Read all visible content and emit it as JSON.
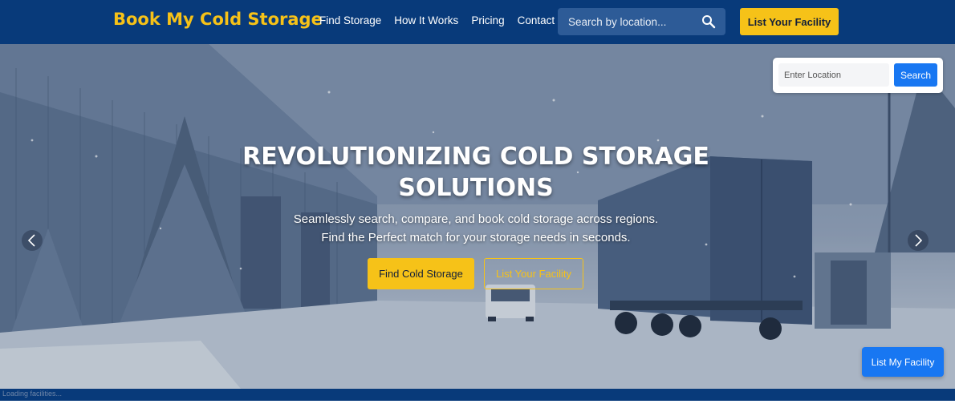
{
  "header": {
    "logo": "Book My Cold Storage",
    "nav": [
      {
        "label": "Find Storage"
      },
      {
        "label": "How It Works"
      },
      {
        "label": "Pricing"
      },
      {
        "label": "Contact"
      }
    ],
    "search_placeholder": "Search by location...",
    "list_button": "List Your Facility"
  },
  "hero": {
    "location_placeholder": "Enter Location",
    "location_search_button": "Search",
    "title_line1": "REVOLUTIONIZING COLD STORAGE",
    "title_line2": "SOLUTIONS",
    "subtitle_line1": "Seamlessly search, compare, and book cold storage across regions.",
    "subtitle_line2": "Find the Perfect match for your storage needs in seconds.",
    "primary_button": "Find Cold Storage",
    "secondary_button": "List Your Facility",
    "floating_button": "List My Facility"
  },
  "status": {
    "text": "Loading facilities..."
  },
  "colors": {
    "header_bg": "#083a7a",
    "brand_yellow": "#f6c218",
    "accent_blue": "#1877f2"
  },
  "icons": [
    "search-icon",
    "chevron-left-icon",
    "chevron-right-icon"
  ]
}
